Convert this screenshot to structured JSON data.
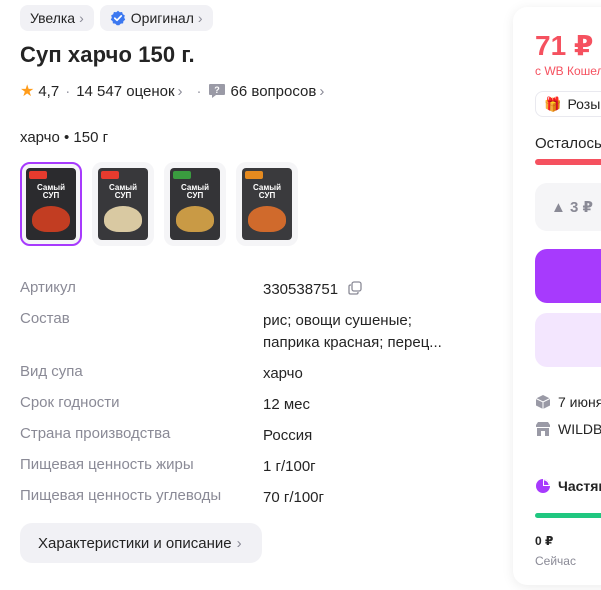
{
  "chips": {
    "brand_label": "Увелка",
    "original_label": "Оригинал"
  },
  "product": {
    "title": "Суп харчо 150 г."
  },
  "rating": {
    "value": "4,7",
    "reviews_label": "14 547 оценок",
    "questions_label": "66 вопросов"
  },
  "variant": {
    "label": "харчо • 150 г"
  },
  "thumbnails": [
    {
      "pack_label": "Самый СУП",
      "selected": true
    },
    {
      "pack_label": "Самый СУП",
      "selected": false
    },
    {
      "pack_label": "Самый СУП",
      "selected": false
    },
    {
      "pack_label": "Самый СУП",
      "selected": false
    }
  ],
  "specs": [
    {
      "key": "Артикул",
      "value": "330538751"
    },
    {
      "key": "Состав",
      "value": "рис; овощи сушеные; паприка красная; перец..."
    },
    {
      "key": "Вид супа",
      "value": "харчо"
    },
    {
      "key": "Срок годности",
      "value": "12 мес"
    },
    {
      "key": "Страна производства",
      "value": "Россия"
    },
    {
      "key": "Пищевая ценность жиры",
      "value": "1 г/100г"
    },
    {
      "key": "Пищевая ценность углеводы",
      "value": "70 г/100г"
    }
  ],
  "description_button": {
    "label": "Характеристики и описание"
  },
  "side": {
    "price": "71 ₽",
    "wallet_label": "с WB Кошельком",
    "promo_label": "Розыгрыш",
    "stock_label": "Осталось",
    "delta_label": "▲ 3 ₽",
    "delivery_date": "7 июня",
    "pickup_label": "WILDBERRIES",
    "installments_label": "Частями",
    "pay_amount": "0 ₽",
    "pay_when": "Сейчас"
  },
  "colors": {
    "accent": "#a73afd",
    "price": "#f5515f",
    "green": "#20c780",
    "muted": "#8a8a96"
  }
}
